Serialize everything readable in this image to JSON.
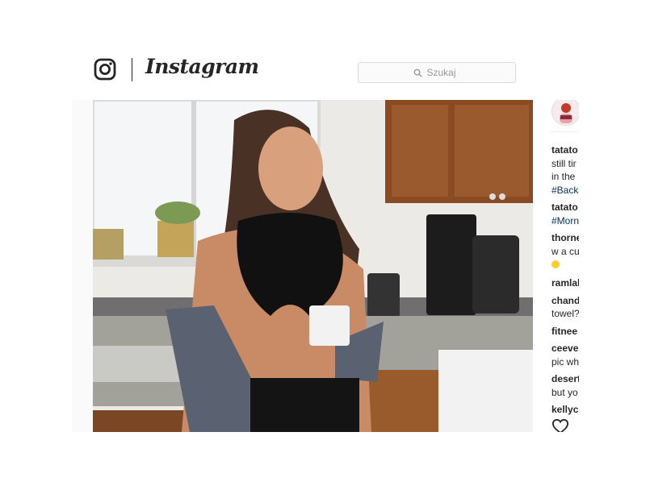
{
  "header": {
    "brand": "Instagram",
    "search_placeholder": "Szukaj"
  },
  "comments": [
    {
      "lines": [
        "tatato",
        "still tir",
        "in the"
      ],
      "tag": "#Back"
    },
    {
      "lines": [
        "tatato"
      ],
      "tag": "#Morn"
    },
    {
      "lines": [
        "thorne",
        "w a cu"
      ],
      "emoji": true
    },
    {
      "lines": [
        "ramlal"
      ]
    },
    {
      "lines": [
        "chand",
        "towel?"
      ]
    },
    {
      "lines": [
        "fitnee"
      ]
    },
    {
      "lines": [
        "ceevel",
        "pic wh"
      ]
    },
    {
      "lines": [
        "desert",
        "but yo"
      ]
    },
    {
      "lines": [
        "kellyc"
      ]
    }
  ],
  "icons": {
    "logo": "instagram-camera-icon",
    "search": "search-icon",
    "like": "heart-icon"
  },
  "colors": {
    "hashtag": "#003569",
    "text": "#262626",
    "border": "#dbdbdb"
  }
}
